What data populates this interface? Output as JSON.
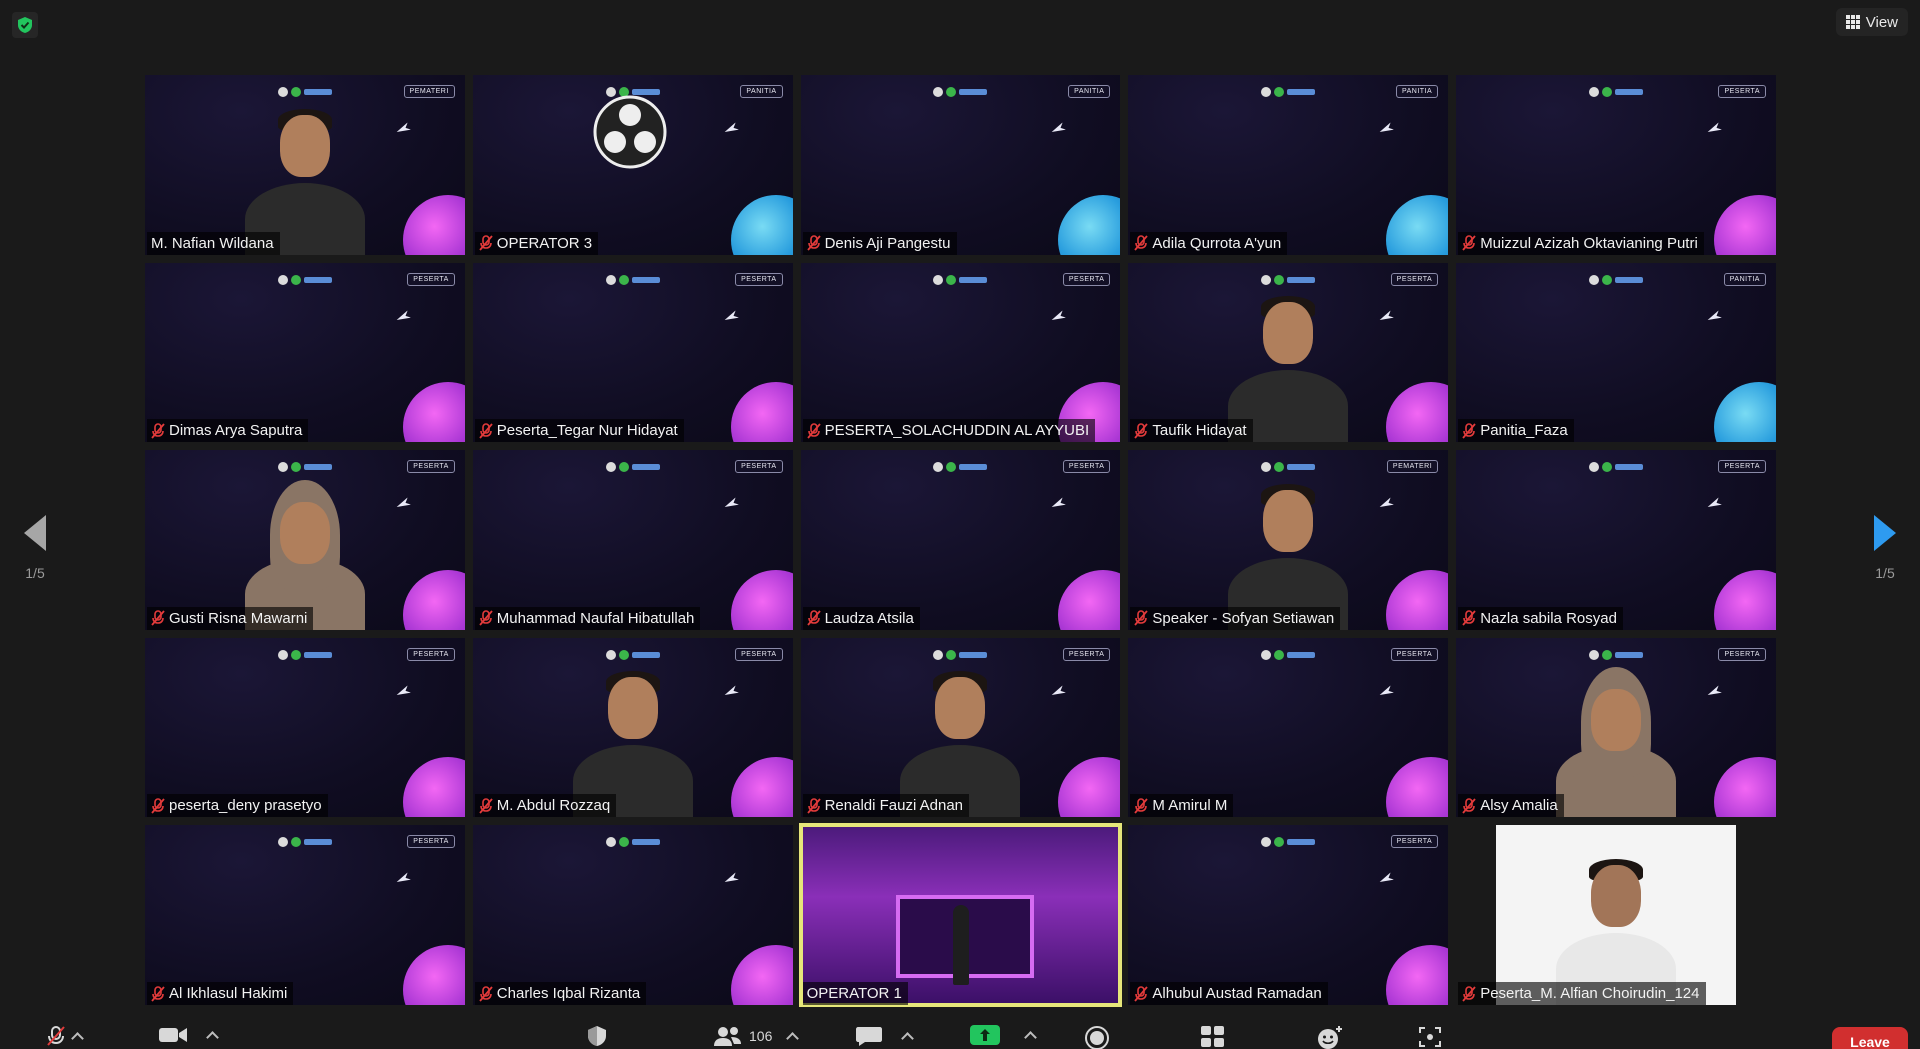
{
  "top": {
    "view_label": "View"
  },
  "pagination": {
    "left_page": "1/5",
    "right_page": "1/5"
  },
  "tiles": [
    {
      "name": "M. Nafian Wildana",
      "tag": "PEMATERI",
      "muted": false,
      "video": "person",
      "planet": "pink"
    },
    {
      "name": "OPERATOR 3",
      "tag": "PANITIA",
      "muted": true,
      "video": "obs",
      "planet": "blue"
    },
    {
      "name": "Denis Aji Pangestu",
      "tag": "PANITIA",
      "muted": true,
      "video": "none",
      "planet": "blue"
    },
    {
      "name": "Adila Qurrota A'yun",
      "tag": "PANITIA",
      "muted": true,
      "video": "none",
      "planet": "blue"
    },
    {
      "name": "Muizzul Azizah Oktavianing Putri",
      "tag": "PESERTA",
      "muted": true,
      "video": "none",
      "planet": "pink"
    },
    {
      "name": "Dimas Arya Saputra",
      "tag": "PESERTA",
      "muted": true,
      "video": "none",
      "planet": "pink"
    },
    {
      "name": "Peserta_Tegar Nur Hidayat",
      "tag": "PESERTA",
      "muted": true,
      "video": "none",
      "planet": "pink"
    },
    {
      "name": "PESERTA_SOLACHUDDIN AL AYYUBI",
      "tag": "PESERTA",
      "muted": true,
      "video": "none",
      "planet": "pink"
    },
    {
      "name": "Taufik Hidayat",
      "tag": "PESERTA",
      "muted": true,
      "video": "person",
      "planet": "pink"
    },
    {
      "name": "Panitia_Faza",
      "tag": "PANITIA",
      "muted": true,
      "video": "none",
      "planet": "blue"
    },
    {
      "name": "Gusti Risna Mawarni",
      "tag": "PESERTA",
      "muted": true,
      "video": "hijab",
      "planet": "pink"
    },
    {
      "name": "Muhammad Naufal Hibatullah",
      "tag": "PESERTA",
      "muted": true,
      "video": "none",
      "planet": "pink"
    },
    {
      "name": "Laudza Atsila",
      "tag": "PESERTA",
      "muted": true,
      "video": "none",
      "planet": "pink"
    },
    {
      "name": "Speaker - Sofyan Setiawan",
      "tag": "PEMATERI",
      "muted": true,
      "video": "person",
      "planet": "pink"
    },
    {
      "name": "Nazla sabila Rosyad",
      "tag": "PESERTA",
      "muted": true,
      "video": "none",
      "planet": "pink"
    },
    {
      "name": "peserta_deny prasetyo",
      "tag": "PESERTA",
      "muted": true,
      "video": "none",
      "planet": "pink"
    },
    {
      "name": "M. Abdul Rozzaq",
      "tag": "PESERTA",
      "muted": true,
      "video": "person",
      "planet": "pink"
    },
    {
      "name": "Renaldi Fauzi Adnan",
      "tag": "PESERTA",
      "muted": true,
      "video": "person",
      "planet": "pink"
    },
    {
      "name": "M Amirul M",
      "tag": "PESERTA",
      "muted": true,
      "video": "none",
      "planet": "pink"
    },
    {
      "name": "Alsy Amalia",
      "tag": "PESERTA",
      "muted": true,
      "video": "hijab",
      "planet": "pink"
    },
    {
      "name": "Al Ikhlasul Hakimi",
      "tag": "PESERTA",
      "muted": true,
      "video": "none",
      "planet": "pink"
    },
    {
      "name": "Charles Iqbal Rizanta",
      "tag": "",
      "muted": true,
      "video": "none",
      "planet": "pink"
    },
    {
      "name": "OPERATOR 1",
      "tag": "",
      "muted": false,
      "video": "stage",
      "planet": "none",
      "highlight": true
    },
    {
      "name": "Alhubul Austad Ramadan",
      "tag": "PESERTA",
      "muted": true,
      "video": "none",
      "planet": "pink"
    },
    {
      "name": "Peserta_M. Alfian Choirudin_124",
      "tag": "",
      "muted": true,
      "video": "white",
      "planet": "none"
    }
  ],
  "toolbar": {
    "participants_count": "106",
    "leave_label": "Leave"
  },
  "colors": {
    "background": "#1a1a1a",
    "highlight_border": "#e6e67a",
    "muted_red": "#e23b3b",
    "leave_red": "#d12f2f",
    "share_green": "#22c55e",
    "active_arrow_blue": "#2e9bf0"
  }
}
